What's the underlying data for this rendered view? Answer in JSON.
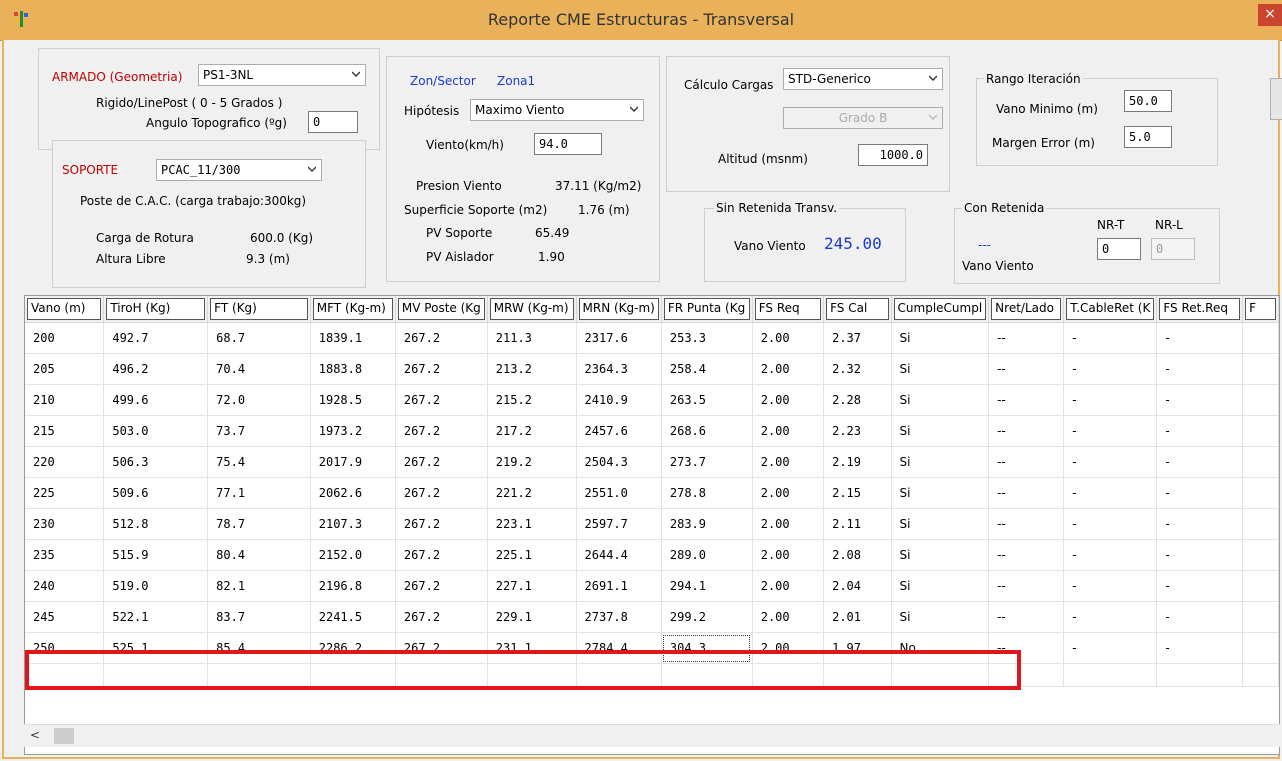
{
  "window": {
    "title": "Reporte CME Estructuras - Transversal",
    "close_label": "×"
  },
  "armado": {
    "label": "ARMADO (Geometria)",
    "value": "PS1-3NL",
    "desc": "Rigido/LinePost ( 0 - 5 Grados )",
    "angulo_label": "Angulo Topografico (ºg)",
    "angulo_value": "0"
  },
  "soporte": {
    "label": "SOPORTE",
    "value": "PCAC_11/300",
    "desc": "Poste de C.A.C. (carga trabajo:300kg)",
    "carga_label": "Carga de Rotura",
    "carga_value": "600.0 (Kg)",
    "altura_label": "Altura Libre",
    "altura_value": "9.3 (m)"
  },
  "zona": {
    "label": "Zon/Sector",
    "value": "Zona1",
    "hipotesis_label": "Hipótesis",
    "hipotesis_value": "Maximo Viento",
    "viento_label": "Viento(km/h)",
    "viento_value": "94.0",
    "presion_label": "Presion Viento",
    "presion_value": "37.11 (Kg/m2)",
    "superficie_label": "Superficie Soporte (m2)",
    "superficie_value": "1.76 (m)",
    "pv_soporte_label": "PV Soporte",
    "pv_soporte_value": "65.49",
    "pv_aislador_label": "PV Aislador",
    "pv_aislador_value": "1.90"
  },
  "calculo": {
    "label": "Cálculo Cargas",
    "value": "STD-Generico",
    "grado_value": "Grado B",
    "altitud_label": "Altitud (msnm)",
    "altitud_value": "1000.0"
  },
  "sin_retenida": {
    "title": "Sin Retenida Transv.",
    "vano_label": "Vano Viento",
    "vano_value": "245.00"
  },
  "rango": {
    "title": "Rango Iteración",
    "vano_min_label": "Vano Minimo (m)",
    "vano_min_value": "50.0",
    "margen_label": "Margen Error (m)",
    "margen_value": "5.0"
  },
  "con_retenida": {
    "title": "Con Retenida",
    "nrt_label": "NR-T",
    "nrl_label": "NR-L",
    "dash": "---",
    "vano_label": "Vano Viento",
    "nrt_value": "0",
    "nrl_value": "0"
  },
  "table": {
    "columns": [
      "Vano (m)",
      "TiroH (Kg)",
      "FT  (Kg)",
      "MFT  (Kg-m)",
      "MV Poste (Kg",
      "MRW  (Kg-m)",
      "MRN (Kg-m)",
      "FR Punta (Kg",
      "FS Req",
      "FS Cal",
      "CumpleCumpl",
      "Nret/Lado",
      "T.CableRet (K",
      "FS Ret.Req",
      "F"
    ],
    "rows": [
      [
        "200",
        "492.7",
        "68.7",
        "1839.1",
        "267.2",
        "211.3",
        "2317.6",
        "253.3",
        "2.00",
        "2.37",
        "Si",
        "--",
        "-",
        "-",
        ""
      ],
      [
        "205",
        "496.2",
        "70.4",
        "1883.8",
        "267.2",
        "213.2",
        "2364.3",
        "258.4",
        "2.00",
        "2.32",
        "Si",
        "--",
        "-",
        "-",
        ""
      ],
      [
        "210",
        "499.6",
        "72.0",
        "1928.5",
        "267.2",
        "215.2",
        "2410.9",
        "263.5",
        "2.00",
        "2.28",
        "Si",
        "--",
        "-",
        "-",
        ""
      ],
      [
        "215",
        "503.0",
        "73.7",
        "1973.2",
        "267.2",
        "217.2",
        "2457.6",
        "268.6",
        "2.00",
        "2.23",
        "Si",
        "--",
        "-",
        "-",
        ""
      ],
      [
        "220",
        "506.3",
        "75.4",
        "2017.9",
        "267.2",
        "219.2",
        "2504.3",
        "273.7",
        "2.00",
        "2.19",
        "Si",
        "--",
        "-",
        "-",
        ""
      ],
      [
        "225",
        "509.6",
        "77.1",
        "2062.6",
        "267.2",
        "221.2",
        "2551.0",
        "278.8",
        "2.00",
        "2.15",
        "Si",
        "--",
        "-",
        "-",
        ""
      ],
      [
        "230",
        "512.8",
        "78.7",
        "2107.3",
        "267.2",
        "223.1",
        "2597.7",
        "283.9",
        "2.00",
        "2.11",
        "Si",
        "--",
        "-",
        "-",
        ""
      ],
      [
        "235",
        "515.9",
        "80.4",
        "2152.0",
        "267.2",
        "225.1",
        "2644.4",
        "289.0",
        "2.00",
        "2.08",
        "Si",
        "--",
        "-",
        "-",
        ""
      ],
      [
        "240",
        "519.0",
        "82.1",
        "2196.8",
        "267.2",
        "227.1",
        "2691.1",
        "294.1",
        "2.00",
        "2.04",
        "Si",
        "--",
        "-",
        "-",
        ""
      ],
      [
        "245",
        "522.1",
        "83.7",
        "2241.5",
        "267.2",
        "229.1",
        "2737.8",
        "299.2",
        "2.00",
        "2.01",
        "Si",
        "--",
        "-",
        "-",
        ""
      ],
      [
        "250",
        "525.1",
        "85.4",
        "2286.2",
        "267.2",
        "231.1",
        "2784.4",
        "304.3",
        "2.00",
        "1.97",
        "No",
        "--",
        "-",
        "-",
        ""
      ]
    ]
  },
  "scroll": {
    "left_arrow": "<"
  },
  "colors": {
    "titlebar": "#e8b15a",
    "highlight": "#e0161f",
    "accent_blue": "#1a3acc",
    "label_red": "#c00000"
  }
}
